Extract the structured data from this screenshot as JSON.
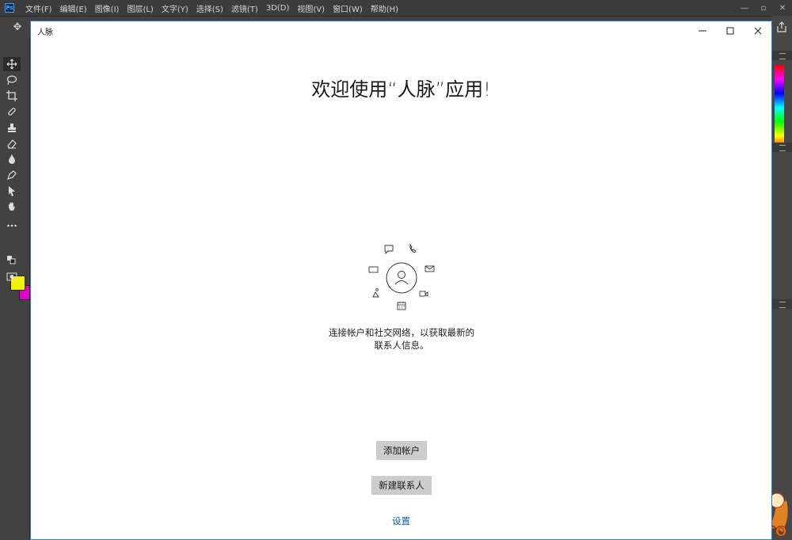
{
  "photoshop": {
    "logo_text": "Ps",
    "menu": [
      "文件(F)",
      "编辑(E)",
      "图像(I)",
      "图层(L)",
      "文字(Y)",
      "选择(S)",
      "滤镜(T)",
      "3D(D)",
      "视图(V)",
      "窗口(W)",
      "帮助(H)"
    ],
    "window_controls": [
      "—",
      "▫",
      "✕"
    ],
    "foreground_color": "#f3f100",
    "background_color": "#e000d0",
    "panel_bg": "#535353"
  },
  "people_app": {
    "title": "人脉",
    "welcome": "欢迎使用“人脉”应用!",
    "description_line1": "连接帐户和社交网络，以获取最新的",
    "description_line2": "联系人信息。",
    "add_account_label": "添加帐户",
    "new_contact_label": "新建联系人",
    "settings_label": "设置",
    "accent_color": "#0063b1",
    "button_color": "#cccccc"
  }
}
